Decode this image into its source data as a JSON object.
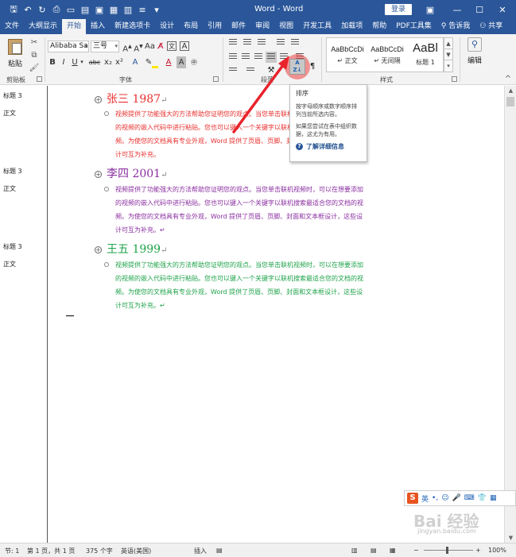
{
  "window": {
    "title": "Word - Word",
    "login_label": "登录",
    "controls": [
      "restore-ribbon",
      "minimize",
      "maximize",
      "close"
    ]
  },
  "qat_icons": [
    "save-icon",
    "undo-icon",
    "redo-icon",
    "print-preview-icon",
    "new-doc-icon",
    "open-icon",
    "paste-icon",
    "new-window-icon",
    "grid-icon",
    "customize-icon"
  ],
  "tabs": [
    {
      "label": "文件",
      "active": false
    },
    {
      "label": "大纲显示",
      "active": false
    },
    {
      "label": "开始",
      "active": true
    },
    {
      "label": "插入",
      "active": false
    },
    {
      "label": "新建选项卡",
      "active": false
    },
    {
      "label": "设计",
      "active": false
    },
    {
      "label": "布局",
      "active": false
    },
    {
      "label": "引用",
      "active": false
    },
    {
      "label": "邮件",
      "active": false
    },
    {
      "label": "审阅",
      "active": false
    },
    {
      "label": "视图",
      "active": false
    },
    {
      "label": "开发工具",
      "active": false
    },
    {
      "label": "加载项",
      "active": false
    },
    {
      "label": "帮助",
      "active": false
    },
    {
      "label": "PDF工具集",
      "active": false
    }
  ],
  "tell_me": "告诉我",
  "share": "共享",
  "ribbon": {
    "clipboard": {
      "paste_label": "粘贴",
      "group_label": "剪贴板"
    },
    "font": {
      "font_name": "Alibaba Sans",
      "font_size": "三号",
      "group_label": "字体",
      "format_buttons": [
        "B",
        "I",
        "U",
        "abc",
        "x₂",
        "x²",
        "A",
        "A",
        "A"
      ]
    },
    "paragraph": {
      "group_label": "段落"
    },
    "styles": {
      "group_label": "样式",
      "items": [
        {
          "sample": "AaBbCcDi",
          "name": "↵ 正文"
        },
        {
          "sample": "AaBbCcDi",
          "name": "↵ 无间隔"
        },
        {
          "sample": "AaBl",
          "name": "标题 1"
        }
      ]
    },
    "editing": {
      "label": "编辑"
    }
  },
  "tooltip": {
    "title": "排序",
    "line1": "按字母顺序或数字顺序排列当前所选内容。",
    "line2": "如果您尝试在表中组织数据，这尤为有用。",
    "more": "了解详细信息"
  },
  "left_pane": [
    {
      "label": "标题 3"
    },
    {
      "label": "正文"
    },
    {
      "label": "标题 3"
    },
    {
      "label": "正文"
    },
    {
      "label": "标题 3"
    },
    {
      "label": "正文"
    }
  ],
  "document": {
    "sections": [
      {
        "heading": "张三 1987",
        "color": "#e8312f",
        "body": "视频提供了功能强大的方法帮助您证明您的观点。当您单击联机视频时，可以在想要添加的视频的嵌入代码中进行粘贴。您也可以键入一个关键字以联机搜索最适合您的文档的视频。为使您的文档具有专业外观，Word 提供了页眉、页脚、封面和文本框设计，这些设计可互为补充。"
      },
      {
        "heading": "李四 2001",
        "color": "#8a2ea0",
        "body": "视频提供了功能强大的方法帮助您证明您的观点。当您单击联机视频时，可以在想要添加的视频的嵌入代码中进行粘贴。您也可以键入一个关键字以联机搜索最适合您的文档的视频。为使您的文档具有专业外观，Word 提供了页眉、页脚、封面和文本框设计，这些设计可互为补充。↵"
      },
      {
        "heading": "王五 1999",
        "color": "#1fa34a",
        "body": "视频提供了功能强大的方法帮助您证明您的观点。当您单击联机视频时，可以在想要添加的视频的嵌入代码中进行粘贴。您也可以键入一个关键字以联机搜索最适合您的文档的视频。为使您的文档具有专业外观，Word 提供了页眉、页脚、封面和文本框设计，这些设计可互为补充。↵"
      }
    ]
  },
  "ime": {
    "logo": "S",
    "mode": "英"
  },
  "watermark": {
    "brand": "Bai 经验",
    "url": "jingyan.baidu.com"
  },
  "status": {
    "section": "节: 1",
    "page": "第 1 页，共 1 页",
    "words": "375 个字",
    "language": "英语(美国)",
    "insert_mode": "插入",
    "zoom": "100%"
  },
  "colors": {
    "brand": "#2b579a",
    "highlight": "#ec4040"
  }
}
